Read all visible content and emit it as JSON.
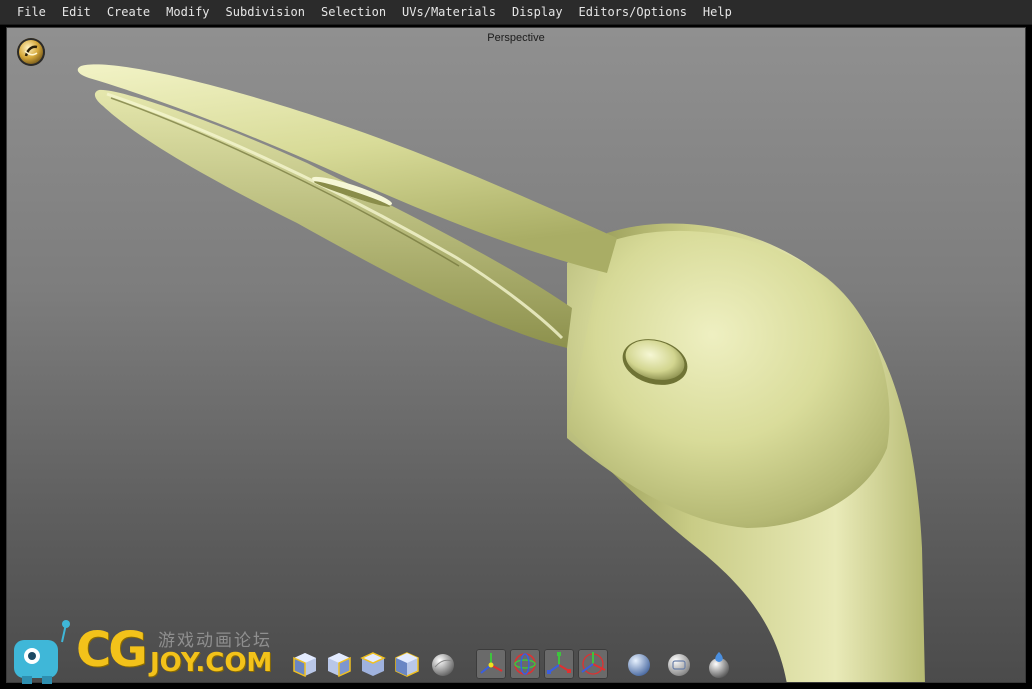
{
  "menu": {
    "items": [
      "File",
      "Edit",
      "Create",
      "Modify",
      "Subdivision",
      "Selection",
      "UVs/Materials",
      "Display",
      "Editors/Options",
      "Help"
    ]
  },
  "viewport": {
    "title": "Perspective",
    "camera_icon": "camera-view-icon"
  },
  "toolbar": {
    "icons": [
      "cube-front-icon",
      "cube-side-icon",
      "cube-top-icon",
      "cube-persp-icon",
      "sphere-icon",
      "move-tool-icon",
      "rotate-tool-icon",
      "scale-tool-icon",
      "universal-tool-icon",
      "shaded-sphere-icon",
      "wireframe-sphere-icon",
      "material-sphere-icon"
    ]
  },
  "watermark": {
    "chinese": "游戏动画论坛",
    "logo_main": "CG",
    "logo_sub": "JOY.COM"
  },
  "colors": {
    "menubar": "#2b2b2b",
    "model_surface": "#d9dc9a",
    "watermark": "#f3c21a"
  }
}
